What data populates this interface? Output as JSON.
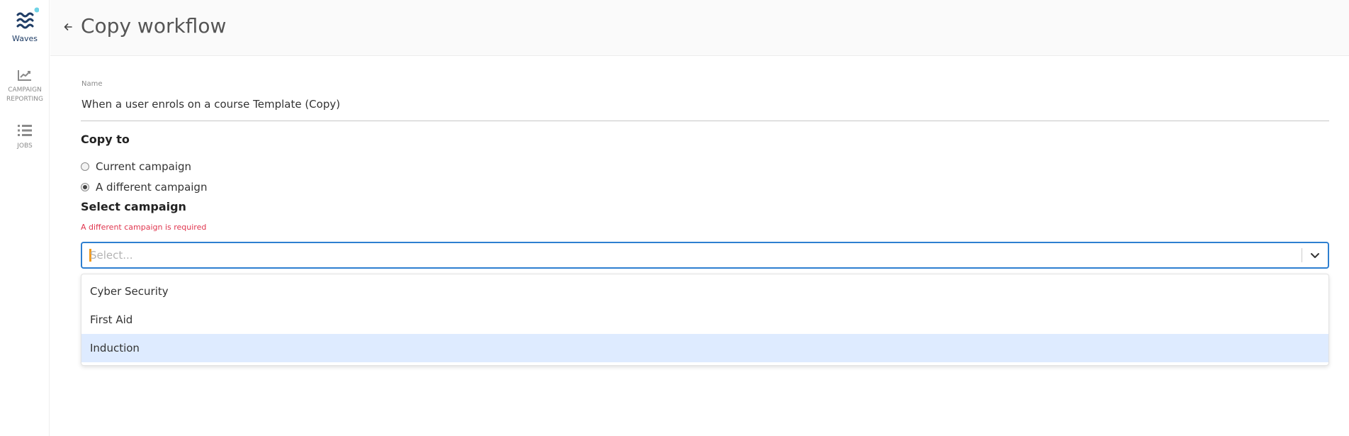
{
  "sidebar": {
    "logo_text": "Waves",
    "items": [
      {
        "label": "CAMPAIGN\nREPORTING",
        "icon": "chart-line-icon"
      },
      {
        "label": "JOBS",
        "icon": "list-icon"
      }
    ]
  },
  "header": {
    "title": "Copy workflow"
  },
  "form": {
    "name_label": "Name",
    "name_value": "When a user enrols on a course Template (Copy)",
    "copy_to_heading": "Copy to",
    "radio_options": [
      {
        "label": "Current campaign",
        "checked": false
      },
      {
        "label": "A different campaign",
        "checked": true
      }
    ],
    "select_heading": "Select campaign",
    "error": "A different campaign is required",
    "select_placeholder": "Select...",
    "dropdown_options": [
      {
        "label": "Cyber Security",
        "focused": false
      },
      {
        "label": "First Aid",
        "focused": false
      },
      {
        "label": "Induction",
        "focused": true
      }
    ]
  },
  "colors": {
    "brand": "#1f3d66",
    "brand_dot": "#6fd3e6",
    "focus_border": "#2e7fd0",
    "error": "#e0364f",
    "option_highlight": "#deebff"
  }
}
